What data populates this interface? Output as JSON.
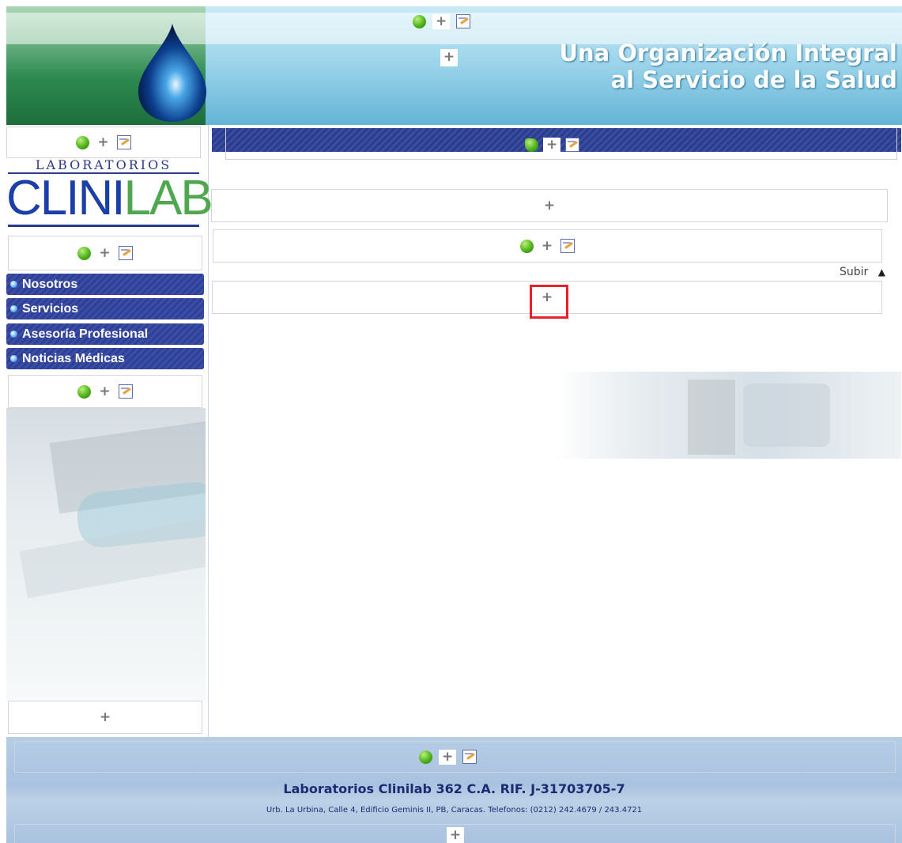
{
  "header": {
    "slogan_line1": "Una Organización Integral",
    "slogan_line2": "al Servicio de la Salud"
  },
  "logo": {
    "top_text": "LABORATORIOS",
    "brand_left": "CLINI",
    "brand_right": "LAB"
  },
  "nav": {
    "items": [
      {
        "label": "Nosotros"
      },
      {
        "label": "Servicios"
      },
      {
        "label": "Asesoría Profesional"
      },
      {
        "label": "Noticias Médicas"
      }
    ]
  },
  "main": {
    "subir_label": "Subir"
  },
  "footer": {
    "company": "Laboratorios Clinilab 362 C.A. RIF. J-31703705-7",
    "address": "Urb. La Urbina, Calle 4, Edificio Geminis II, PB, Caracas. Telefonos: (0212) 242.4679 / 243.4721"
  },
  "tools": {
    "plus": "+"
  },
  "colors": {
    "nav_blue": "#2e3f95",
    "footer_blue": "#aac3df",
    "green_accent": "#4fa84f"
  }
}
